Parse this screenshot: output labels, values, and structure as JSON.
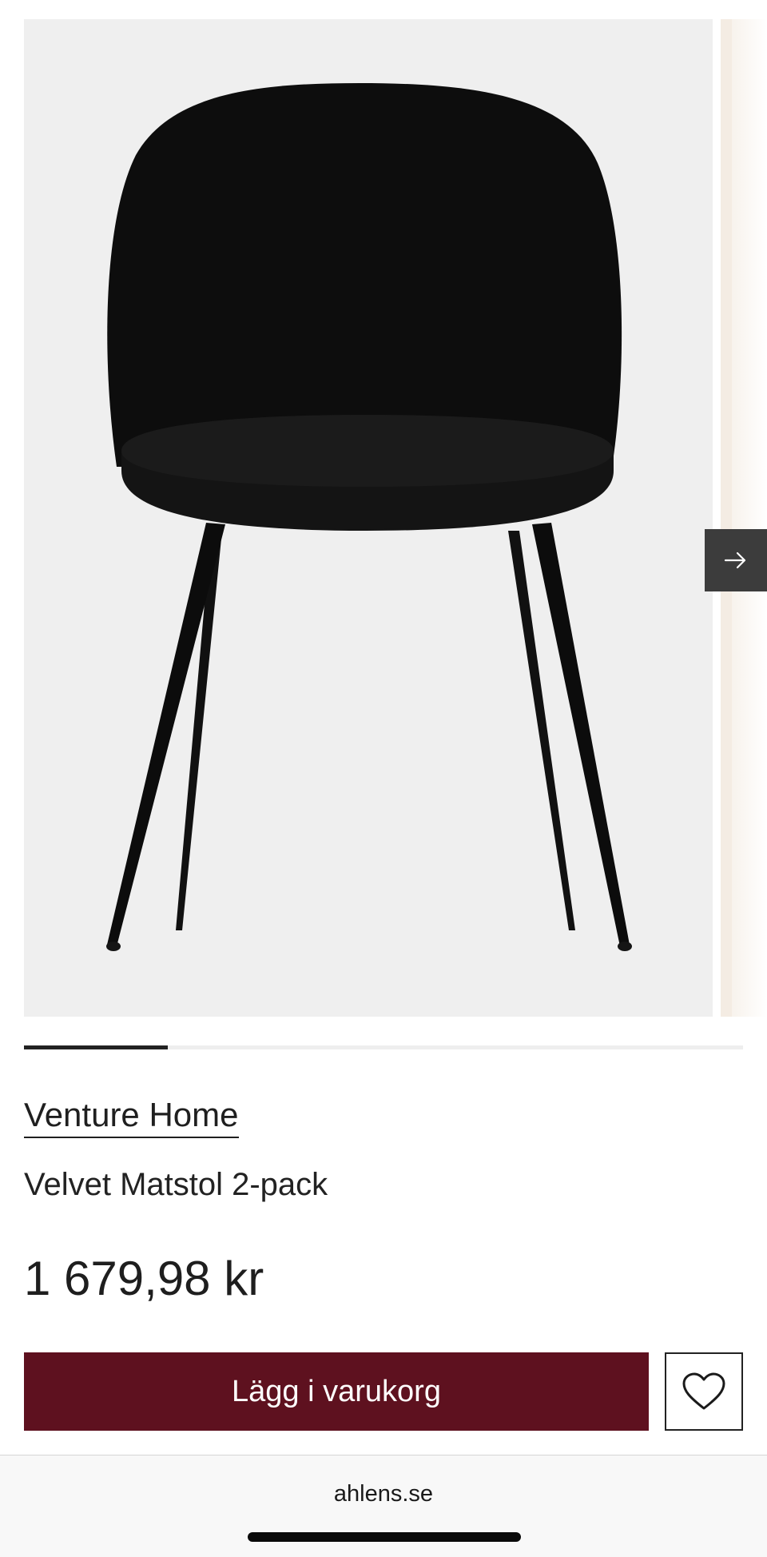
{
  "gallery": {
    "image_label": "Velvet Matstol 2-pack",
    "next_icon": "arrow-right-icon",
    "progress_fraction": 0.2
  },
  "product": {
    "brand": "Venture Home",
    "name": "Velvet Matstol 2-pack",
    "price": "1 679,98 kr"
  },
  "actions": {
    "add_to_cart_label": "Lägg i varukorg",
    "wishlist_icon": "heart-icon"
  },
  "browser": {
    "url": "ahlens.se"
  },
  "colors": {
    "accent": "#5e111f",
    "image_bg": "#efefef",
    "arrow_button_bg": "#3c3c3c",
    "text": "#222222"
  }
}
